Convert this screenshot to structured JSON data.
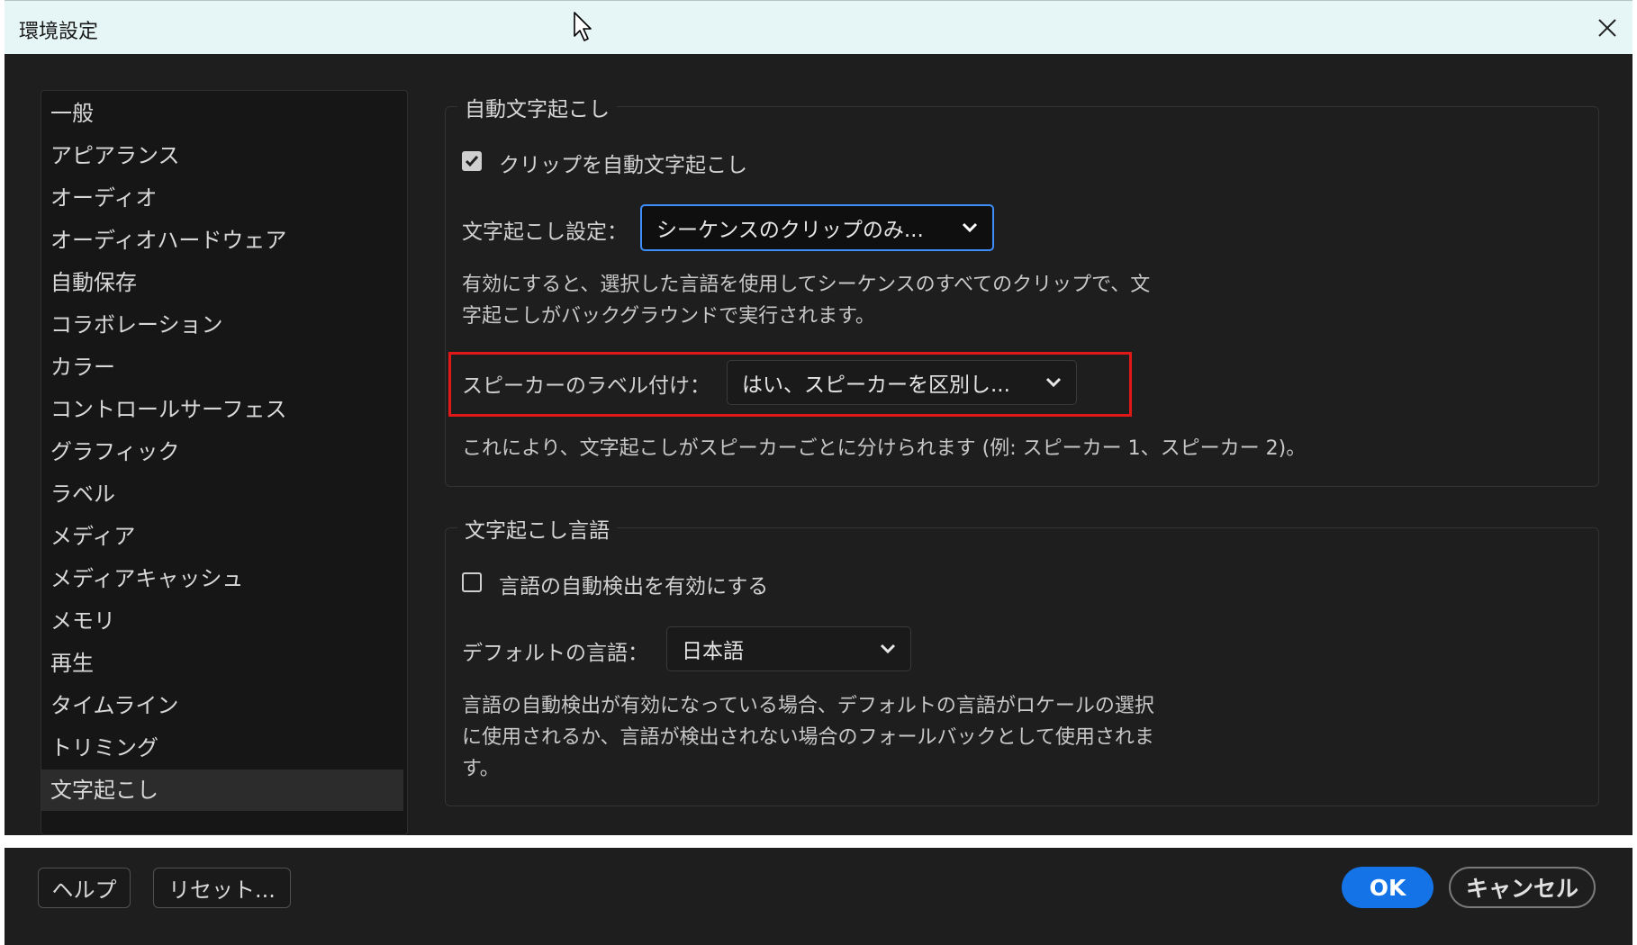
{
  "window": {
    "title": "環境設定"
  },
  "sidebar": {
    "items": [
      {
        "label": "一般"
      },
      {
        "label": "アピアランス"
      },
      {
        "label": "オーディオ"
      },
      {
        "label": "オーディオハードウェア"
      },
      {
        "label": "自動保存"
      },
      {
        "label": "コラボレーション"
      },
      {
        "label": "カラー"
      },
      {
        "label": "コントロールサーフェス"
      },
      {
        "label": "グラフィック"
      },
      {
        "label": "ラベル"
      },
      {
        "label": "メディア"
      },
      {
        "label": "メディアキャッシュ"
      },
      {
        "label": "メモリ"
      },
      {
        "label": "再生"
      },
      {
        "label": "タイムライン"
      },
      {
        "label": "トリミング"
      },
      {
        "label": "文字起こし"
      }
    ],
    "selected_label": "文字起こし"
  },
  "auto_transcribe": {
    "group_title": "自動文字起こし",
    "checkbox_label": "クリップを自動文字起こし",
    "checkbox_checked": true,
    "setting_label": "文字起こし設定：",
    "setting_value": "シーケンスのクリップのみ...",
    "description_line1": "有効にすると、選択した言語を使用してシーケンスのすべてのクリップで、文",
    "description_line2": "字起こしがバックグラウンドで実行されます。",
    "speaker_label": "スピーカーのラベル付け：",
    "speaker_value": "はい、スピーカーを区別し...",
    "speaker_description": "これにより、文字起こしがスピーカーごとに分けられます (例: スピーカー 1、スピーカー 2)。"
  },
  "transcribe_language": {
    "group_title": "文字起こし言語",
    "checkbox_label": "言語の自動検出を有効にする",
    "checkbox_checked": false,
    "default_label": "デフォルトの言語：",
    "default_value": "日本語",
    "description_line1": "言語の自動検出が有効になっている場合、デフォルトの言語がロケールの選択",
    "description_line2": "に使用されるか、言語が検出されない場合のフォールバックとして使用されま",
    "description_line3": "す。"
  },
  "footer": {
    "help_label": "ヘルプ",
    "reset_label": "リセット...",
    "ok_label": "OK",
    "cancel_label": "キャンセル"
  },
  "colors": {
    "accent": "#1473e6",
    "highlight": "#e01818",
    "focus": "#3d8ef8"
  }
}
